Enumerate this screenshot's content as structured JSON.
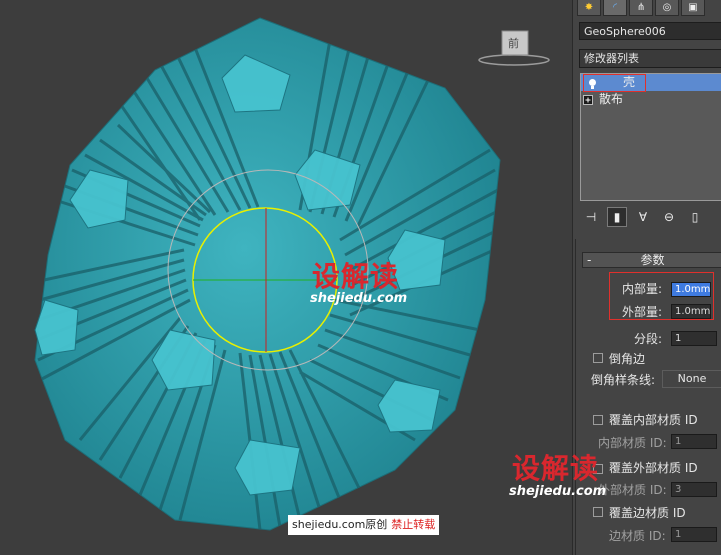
{
  "viewport": {
    "viewcube_label": "前",
    "watermark_brand": "设解读",
    "watermark_url": "shejiedu.com",
    "footer_site": "shejiedu.com",
    "footer_original": "原创",
    "footer_no_repost": "禁止转载"
  },
  "command_panel": {
    "tabs": [
      {
        "icon": "create-icon"
      },
      {
        "icon": "modify-icon"
      },
      {
        "icon": "hierarchy-icon"
      },
      {
        "icon": "motion-icon"
      },
      {
        "icon": "display-icon"
      }
    ],
    "object_name": "GeoSphere006",
    "modifier_list_label": "修改器列表",
    "stack": [
      {
        "label": "壳",
        "icon": "lightbulb-icon",
        "selected": true
      },
      {
        "label": "散布",
        "icon": "expand-plus-icon",
        "selected": false
      }
    ]
  },
  "params": {
    "title": "参数",
    "inner_amount_label": "内部量:",
    "inner_amount_value": "1.0mm",
    "outer_amount_label": "外部量:",
    "outer_amount_value": "1.0mm",
    "segments_label": "分段:",
    "segments_value": "1",
    "bevel_edges_label": "倒角边",
    "bevel_spline_label": "倒角样条线:",
    "bevel_spline_value": "None",
    "override_inner_mat_label": "覆盖内部材质 ID",
    "inner_mat_id_label": "内部材质 ID:",
    "inner_mat_id_value": "1",
    "override_outer_mat_label": "覆盖外部材质 ID",
    "outer_mat_id_label": "外部材质 ID:",
    "outer_mat_id_value": "3",
    "override_edge_mat_label": "覆盖边材质 ID",
    "edge_mat_id_label": "边材质 ID:",
    "edge_mat_id_value": "1"
  }
}
